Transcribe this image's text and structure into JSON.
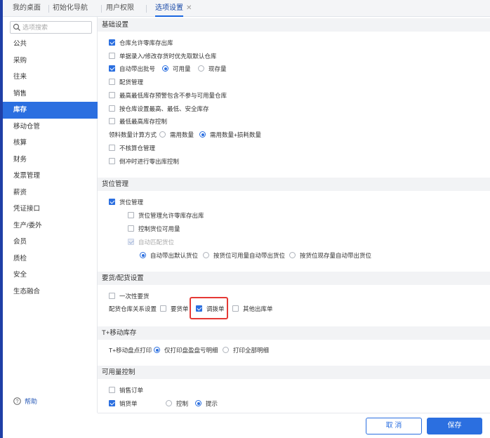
{
  "tabs": [
    {
      "label": "我的桌面"
    },
    {
      "label": "初始化导航"
    },
    {
      "label": "用户权限"
    },
    {
      "label": "选项设置",
      "active": true
    }
  ],
  "sidebar": {
    "search_placeholder": "选项搜索",
    "items": [
      {
        "label": "公共"
      },
      {
        "label": "采购"
      },
      {
        "label": "往来"
      },
      {
        "label": "销售"
      },
      {
        "label": "库存",
        "active": true
      },
      {
        "label": "移动仓管"
      },
      {
        "label": "核算"
      },
      {
        "label": "财务"
      },
      {
        "label": "发票管理"
      },
      {
        "label": "薪资"
      },
      {
        "label": "凭证接口"
      },
      {
        "label": "生产/委外"
      },
      {
        "label": "会员"
      },
      {
        "label": "质检"
      },
      {
        "label": "安全"
      },
      {
        "label": "生态融合"
      }
    ],
    "help_label": "帮助"
  },
  "sections": {
    "basic": {
      "title": "基础设置",
      "allow_zero_stock": {
        "label": "仓库允许零库存出库",
        "checked": true
      },
      "prefer_default_warehouse": {
        "label": "单据录入/修改存货时优先取默认仓库",
        "checked": false
      },
      "auto_batch": {
        "label": "自动带出批号",
        "checked": true
      },
      "auto_batch_opt1": {
        "label": "可用量",
        "selected": true
      },
      "auto_batch_opt2": {
        "label": "现存量",
        "selected": false
      },
      "kit_mgmt": {
        "label": "配货管理",
        "checked": false
      },
      "max_min_stock": {
        "label": "最高最低库存预警包含不参与可用量仓库",
        "checked": false
      },
      "by_warehouse": {
        "label": "按仓库设置最高、最低、安全库存",
        "checked": false
      },
      "min_max_ctrl": {
        "label": "最低最高库存控制",
        "checked": false
      },
      "material_calc_label": "领料数量计算方式",
      "material_opt1": {
        "label": "需用数量",
        "selected": false
      },
      "material_opt2": {
        "label": "需用数量+损耗数量",
        "selected": true
      },
      "no_batch_mgmt": {
        "label": "不核算仓管理",
        "checked": false
      },
      "reverse_zero": {
        "label": "倒冲时进行零出库控制",
        "checked": false
      }
    },
    "location": {
      "title": "货位管理",
      "loc_mgmt": {
        "label": "货位管理",
        "checked": true
      },
      "loc_zero": {
        "label": "货位管理允许零库存出库",
        "checked": false
      },
      "loc_ctrl": {
        "label": "控制货位可用量",
        "checked": false
      },
      "loc_auto": {
        "label": "自动匹配货位",
        "checked": true,
        "disabled": true
      },
      "loc_opt1": {
        "label": "自动带出默认货位",
        "selected": true
      },
      "loc_opt2": {
        "label": "按货位可用量自动带出货位",
        "selected": false
      },
      "loc_opt3": {
        "label": "按货位现存量自动带出货位",
        "selected": false
      }
    },
    "requisition": {
      "title": "要货/配货设置",
      "one_time": {
        "label": "一次性要货",
        "checked": false
      },
      "relation_label": "配货仓库关系设置",
      "req_order": {
        "label": "要货单",
        "checked": false
      },
      "transfer_order": {
        "label": "调拨单",
        "checked": true
      },
      "other_out": {
        "label": "其他出库单",
        "checked": false
      }
    },
    "mobile": {
      "title": "T+移动库存",
      "print_label": "T+移动盘点打印",
      "print_opt1": {
        "label": "仅打印盘盈盘亏明细",
        "selected": true
      },
      "print_opt2": {
        "label": "打印全部明细",
        "selected": false
      }
    },
    "available": {
      "title": "可用量控制",
      "sales_order": {
        "label": "销售订单",
        "checked": false
      },
      "delivery": {
        "label": "销货单",
        "checked": true
      },
      "delivery_opt1": {
        "label": "控制",
        "selected": false
      },
      "delivery_opt2": {
        "label": "提示",
        "selected": true
      }
    }
  },
  "footer": {
    "cancel_label": "取 消",
    "save_label": "保存"
  },
  "colors": {
    "accent": "#2b6fe0",
    "highlight": "#e53935"
  }
}
